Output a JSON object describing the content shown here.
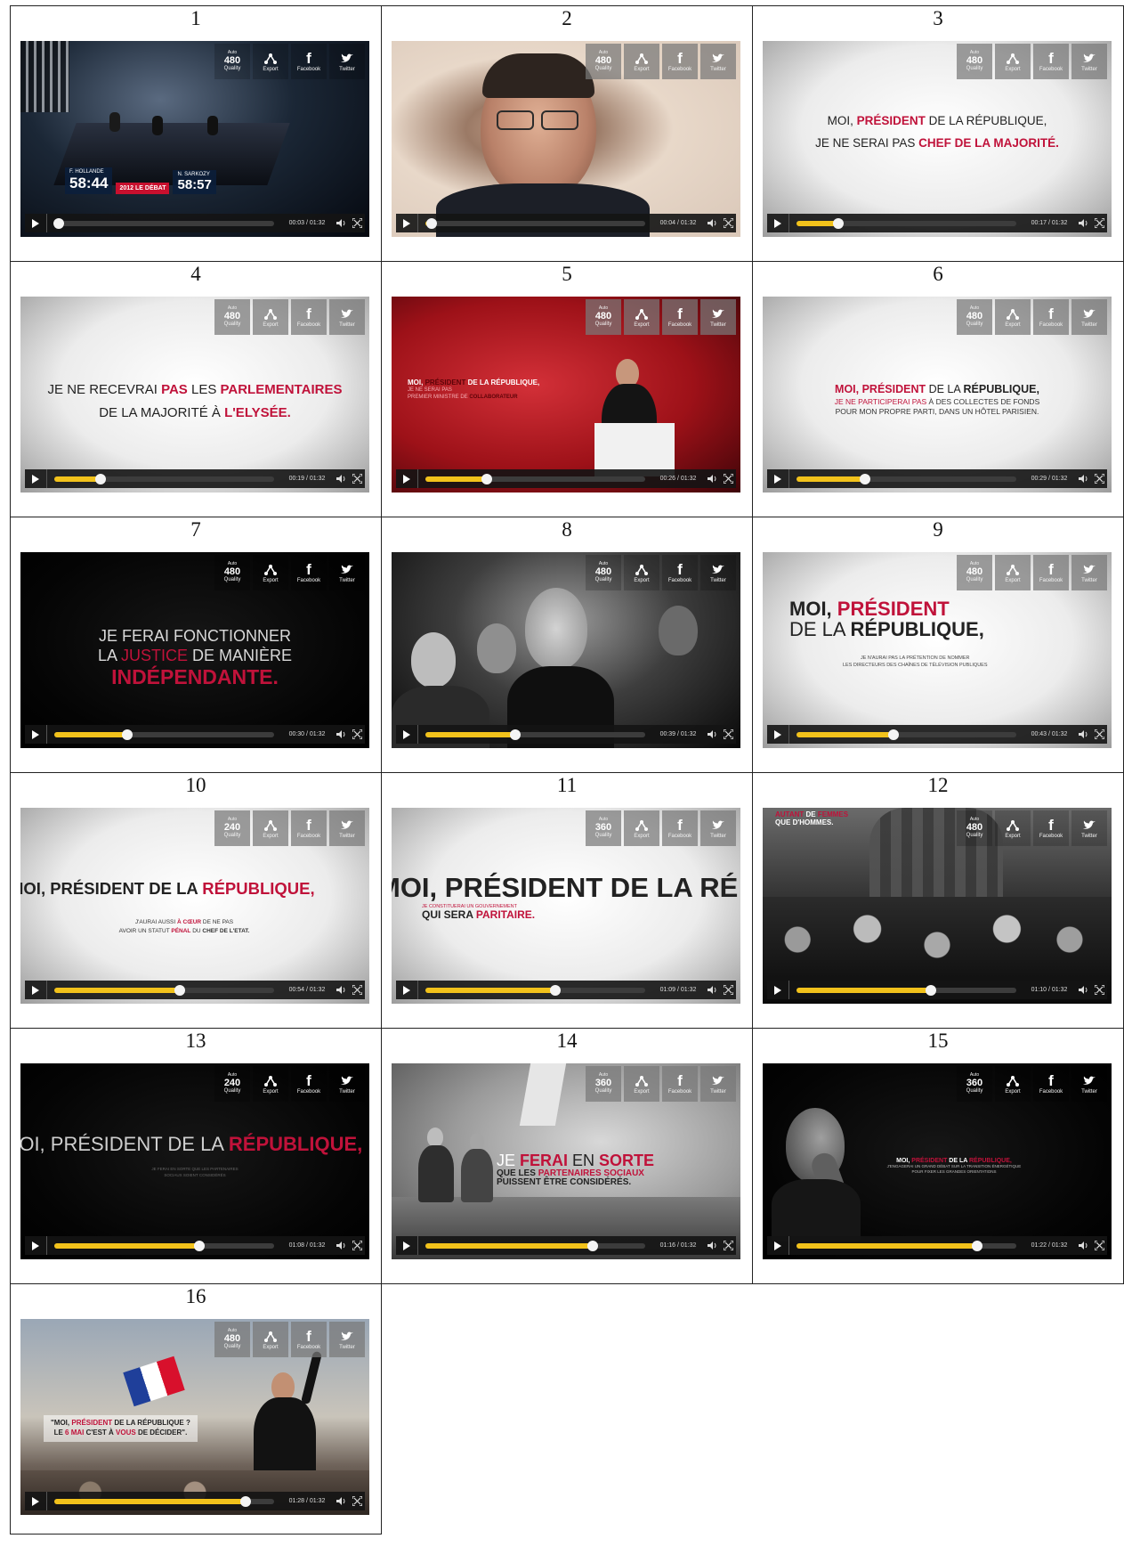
{
  "player": {
    "quality_auto": "Auto",
    "quality_label": "Quality",
    "export_label": "Export",
    "facebook_label": "Facebook",
    "twitter_label": "Twitter"
  },
  "colors": {
    "accent": "#f2c21b",
    "highlight": "#c0123a"
  },
  "frames": [
    {
      "number": "1",
      "quality": "480",
      "time": "00:03 / 01:32",
      "progress": 0.02,
      "studio": {
        "name1": "F. HOLLANDE",
        "clock1": "58:44",
        "name2": "N. SARKOZY",
        "clock2": "58:57",
        "tag": "2012 LE DÉBAT"
      }
    },
    {
      "number": "2",
      "quality": "480",
      "time": "00:04 / 01:32",
      "progress": 0.03
    },
    {
      "number": "3",
      "quality": "480",
      "time": "00:17 / 01:32",
      "progress": 0.19,
      "text": {
        "a": "MOI, ",
        "b": "PRÉSIDENT",
        "c": " DE LA RÉPUBLIQUE,",
        "d": "JE NE SERAI PAS ",
        "e": "CHEF DE LA MAJORITÉ."
      }
    },
    {
      "number": "4",
      "quality": "480",
      "time": "00:19 / 01:32",
      "progress": 0.21,
      "text": {
        "a": "JE NE RECEVRAI ",
        "b": "PAS",
        "c": " LES ",
        "d": "PARLEMENTAIRES",
        "e": "DE LA MAJORITÉ À ",
        "f": "L'ELYSÉE."
      }
    },
    {
      "number": "5",
      "quality": "480",
      "time": "00:26 / 01:32",
      "progress": 0.28,
      "text": {
        "a": "MOI, ",
        "b": "PRÉSIDENT",
        "c": " DE LA RÉPUBLIQUE,",
        "d": "JE NE SERAI PAS",
        "e": "PREMIER MINISTRE DE ",
        "f": "COLLABORATEUR"
      }
    },
    {
      "number": "6",
      "quality": "480",
      "time": "00:29 / 01:32",
      "progress": 0.31,
      "text": {
        "a": "MOI, PRÉSIDENT",
        "b": " DE LA ",
        "c": "RÉPUBLIQUE,",
        "d": "JE NE PARTICIPERAI PAS",
        "e": " À DES COLLECTES DE FONDS",
        "f": "POUR MON PROPRE PARTI, DANS UN HÔTEL PARISIEN."
      }
    },
    {
      "number": "7",
      "quality": "480",
      "time": "00:30 / 01:32",
      "progress": 0.33,
      "text": {
        "a": "JE FERAI FONCTIONNER",
        "b": "LA ",
        "c": "JUSTICE",
        "d": " DE MANIÈRE",
        "e": "INDÉPENDANTE."
      }
    },
    {
      "number": "8",
      "quality": "480",
      "time": "00:39 / 01:32",
      "progress": 0.41
    },
    {
      "number": "9",
      "quality": "480",
      "time": "00:43 / 01:32",
      "progress": 0.44,
      "text": {
        "a": "MOI, ",
        "b": "PRÉSIDENT",
        "c": "DE LA ",
        "d": "RÉPUBLIQUE,",
        "e": "JE N'AURAI PAS LA PRÉTENTION DE NOMMER",
        "f": "LES DIRECTEURS DES CHAÎNES DE TÉLÉVISION PUBLIQUES"
      }
    },
    {
      "number": "10",
      "quality": "240",
      "time": "00:54 / 01:32",
      "progress": 0.57,
      "text": {
        "a": "MOI, PRÉSIDENT DE LA ",
        "b": "RÉPUBLIQUE,",
        "c": "J'AURAI AUSSI ",
        "d": "À CŒUR",
        "e": " DE NE PAS",
        "f": "AVOIR UN STATUT ",
        "g": "PÉNAL",
        "h": " DU ",
        "i": "CHEF DE L'ETAT."
      }
    },
    {
      "number": "11",
      "quality": "360",
      "time": "01:09 / 01:32",
      "progress": 0.59,
      "text": {
        "a": "MOI, PRÉSIDENT DE LA RÉ",
        "b": "JE CONSTITUERAI UN GOUVERNEMENT",
        "c": "QUI SERA ",
        "d": "PARITAIRE."
      }
    },
    {
      "number": "12",
      "quality": "480",
      "time": "01:10 / 01:32",
      "progress": 0.61,
      "text": {
        "a": "AUTANT",
        "b": " DE ",
        "c": "FEMMES",
        "d": "QUE ",
        "e": "D'HOMMES."
      }
    },
    {
      "number": "13",
      "quality": "240",
      "time": "01:08 / 01:32",
      "progress": 0.66,
      "text": {
        "a": "MOI, PRÉSIDENT DE LA ",
        "b": "RÉPUBLIQUE,",
        "c": "JE FERAI EN SORTE QUE LES PARTENAIRES",
        "d": "SOCIAUX SOIENT CONSIDÉRÉS"
      }
    },
    {
      "number": "14",
      "quality": "360",
      "time": "01:16 / 01:32",
      "progress": 0.76,
      "text": {
        "a": "JE ",
        "b": "FERAI",
        "c": " EN ",
        "d": "SORTE",
        "e": "QUE LES ",
        "f": "PARTENAIRES SOCIAUX",
        "g": "PUISSENT ÊTRE ",
        "h": "CONSIDÉRÉS."
      }
    },
    {
      "number": "15",
      "quality": "360",
      "time": "01:22 / 01:32",
      "progress": 0.82,
      "text": {
        "a": "MOI, ",
        "b": "PRÉSIDENT",
        "c": " DE LA ",
        "d": "RÉPUBLIQUE,",
        "e": "J'ENGAGERAI UN GRAND DÉBAT SUR LA TRANSITION ÉNERGÉTIQUE",
        "f": "POUR FIXER LES GRANDES ORIENTATIONS"
      }
    },
    {
      "number": "16",
      "quality": "480",
      "time": "01:28 / 01:32",
      "progress": 0.87,
      "text": {
        "a": "\"MOI, ",
        "b": "PRÉSIDENT",
        "c": " DE LA RÉPUBLIQUE ?",
        "d": "LE ",
        "e": "6 MAI",
        "f": " C'EST À ",
        "g": "VOUS",
        "h": " DE DÉCIDER\"."
      }
    }
  ]
}
